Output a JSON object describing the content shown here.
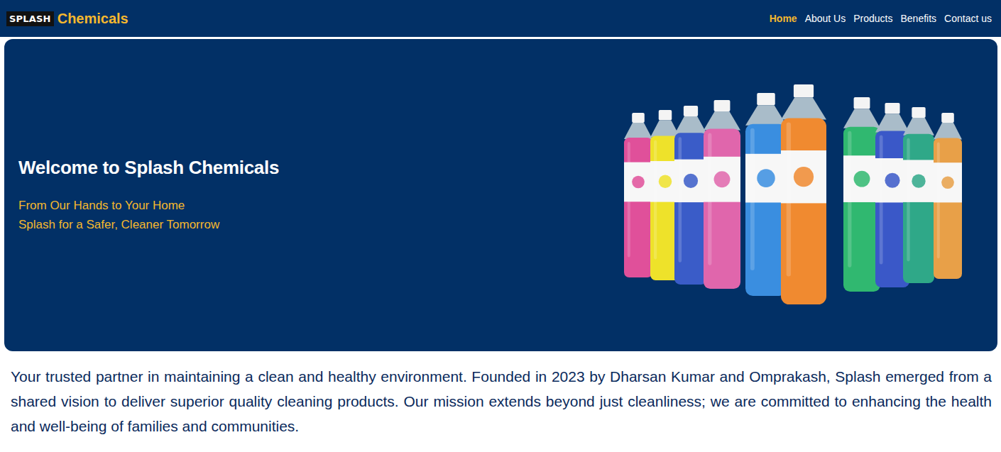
{
  "nav": {
    "brand": {
      "badge": "SPLASH",
      "name": "Chemicals"
    },
    "items": [
      {
        "label": "Home",
        "selected": true
      },
      {
        "label": "About Us",
        "selected": false
      },
      {
        "label": "Products",
        "selected": false
      },
      {
        "label": "Benefits",
        "selected": false
      },
      {
        "label": "Contact us",
        "selected": false
      }
    ]
  },
  "hero": {
    "title": "Welcome to Splash Chemicals",
    "taglines": [
      "From Our Hands to Your Home",
      "Splash for a Safer, Cleaner Tomorrow"
    ]
  },
  "intro": {
    "text": "Your trusted partner in maintaining a clean and healthy environment. Founded in 2023 by Dharsan Kumar and Omprakash, Splash emerged from a shared vision to deliver superior quality cleaning products. Our mission extends beyond just cleanliness; we are committed to enhancing the health and well-being of families and communities."
  }
}
